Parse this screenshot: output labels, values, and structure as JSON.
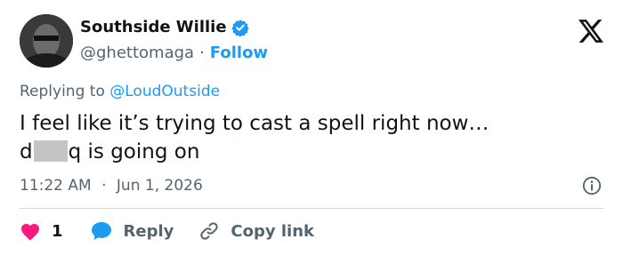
{
  "author": {
    "display_name": "Southside Willie",
    "handle": "@ghettomaga",
    "separator": "·",
    "follow_label": "Follow"
  },
  "reply_context": {
    "prefix": "Replying to",
    "mention": "@LoudOutside"
  },
  "tweet": {
    "line1": "I feel like it’s trying to cast a spell right now…",
    "line2_start": "d",
    "line2_end": "q is going on"
  },
  "meta": {
    "time": "11:22 AM",
    "separator": "·",
    "date": "Jun 1, 2026"
  },
  "actions": {
    "like_count": "1",
    "reply_label": "Reply",
    "copy_link_label": "Copy link"
  },
  "colors": {
    "link": "#1d9bf0",
    "like": "#f91880",
    "reply_icon": "#1d9bf0",
    "muted": "#536471"
  }
}
